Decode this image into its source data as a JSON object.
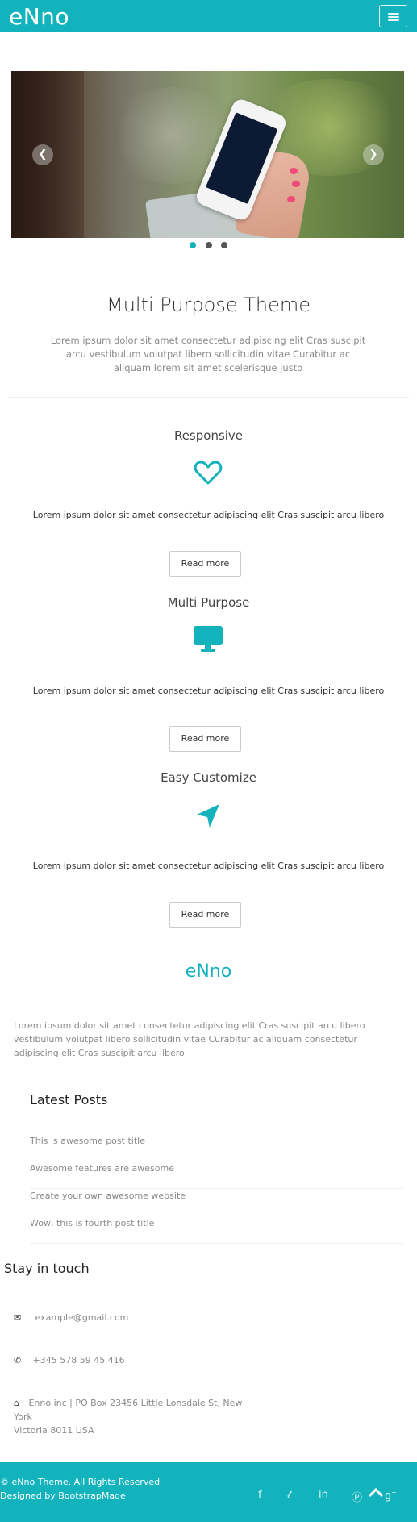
{
  "header": {
    "brand": "eNno",
    "menu_icon": "hamburger-icon"
  },
  "carousel": {
    "prev_icon": "chevron-left-icon",
    "next_icon": "chevron-right-icon",
    "slides": 3,
    "active_slide": 1
  },
  "intro": {
    "title": "Multi Purpose Theme",
    "text": "Lorem ipsum dolor sit amet consectetur adipiscing elit Cras suscipit arcu vestibulum volutpat libero sollicitudin vitae Curabitur ac aliquam lorem sit amet scelerisque justo"
  },
  "features": [
    {
      "title": "Responsive",
      "icon": "heart-icon",
      "text": "Lorem ipsum dolor sit amet consectetur adipiscing elit Cras suscipit arcu libero",
      "button": "Read more"
    },
    {
      "title": "Multi Purpose",
      "icon": "desktop-icon",
      "text": "Lorem ipsum dolor sit amet consectetur adipiscing elit Cras suscipit arcu libero",
      "button": "Read more"
    },
    {
      "title": "Easy Customize",
      "icon": "location-arrow-icon",
      "text": "Lorem ipsum dolor sit amet consectetur adipiscing elit Cras suscipit arcu libero",
      "button": "Read more"
    }
  ],
  "footer": {
    "brand": "eNno",
    "about": "Lorem ipsum dolor sit amet consectetur adipiscing elit Cras suscipit arcu libero vestibulum volutpat libero sollicitudin vitae Curabitur ac aliquam consectetur adipiscing elit Cras suscipit arcu libero",
    "posts_title": "Latest Posts",
    "posts": [
      "This is awesome post title",
      "Awesome features are awesome",
      "Create your own awesome website",
      "Wow, this is fourth post title"
    ],
    "touch_title": "Stay in touch",
    "email": "example@gmail.com",
    "phone": "+345 578 59 45 416",
    "address_line1": "Enno inc | PO Box 23456 Little Lonsdale St, New York",
    "address_line2": "Victoria 8011 USA"
  },
  "bottom": {
    "copyright": "© eNno Theme. All Rights Reserved",
    "designed": "Designed by BootstrapMade",
    "social": [
      "facebook-icon",
      "twitter-icon",
      "linkedin-icon",
      "pinterest-icon",
      "google-plus-icon"
    ],
    "to_top_icon": "chevron-up-icon"
  },
  "colors": {
    "brand": "#12b3bd",
    "text": "#555555",
    "muted": "#8a8a8a"
  }
}
